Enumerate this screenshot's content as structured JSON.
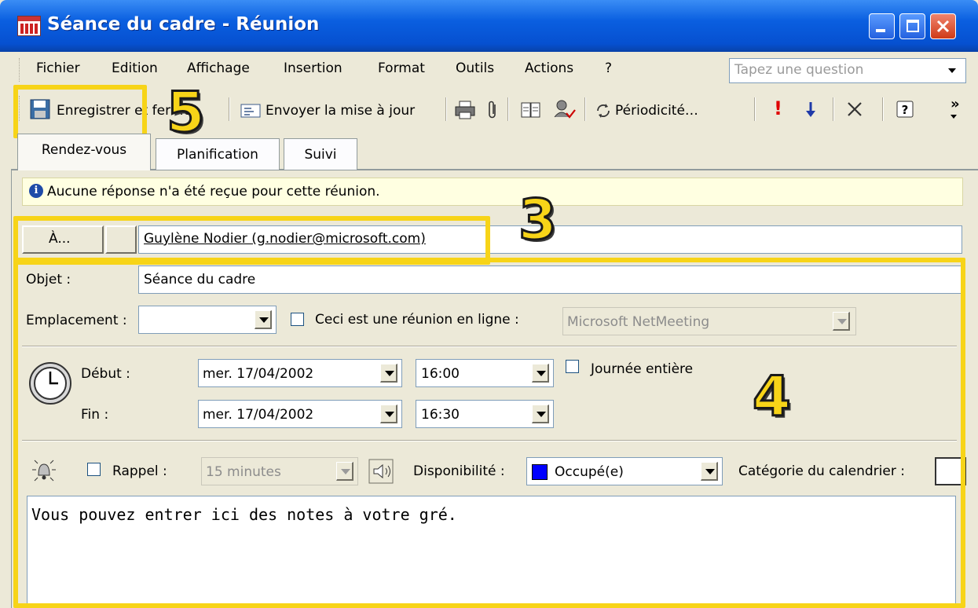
{
  "window": {
    "title": "Séance du cadre - Réunion"
  },
  "menu": {
    "items": [
      "Fichier",
      "Edition",
      "Affichage",
      "Insertion",
      "Format",
      "Outils",
      "Actions",
      "?"
    ],
    "ask_placeholder": "Tapez une question"
  },
  "toolbar": {
    "save_label": "Enregistrer et fermer",
    "send_update_label": "Envoyer la mise à jour",
    "recurrence_label": "Périodicité…",
    "overflow": "»"
  },
  "tabs": [
    "Rendez-vous",
    "Planification",
    "Suivi"
  ],
  "infobar": {
    "text": "Aucune réponse n'a été reçue pour cette réunion."
  },
  "to": {
    "button_label": "À...",
    "value": "Guylène Nodier (g.nodier@microsoft.com)"
  },
  "subject": {
    "label": "Objet :",
    "value": "Séance du cadre"
  },
  "location": {
    "label": "Emplacement :",
    "value": "",
    "online_label": "Ceci est une réunion en ligne :",
    "online_checked": false,
    "online_service": "Microsoft NetMeeting"
  },
  "start": {
    "label": "Début :",
    "date": "mer. 17/04/2002",
    "time": "16:00"
  },
  "end": {
    "label": "Fin :",
    "date": "mer. 17/04/2002",
    "time": "16:30"
  },
  "all_day": {
    "label": "Journée entière",
    "checked": false
  },
  "reminder": {
    "label": "Rappel :",
    "checked": false,
    "value": "15 minutes"
  },
  "availability": {
    "label": "Disponibilité :",
    "value": "Occupé(e)",
    "color": "#0000ff"
  },
  "calendar_category": {
    "label": "Catégorie du calendrier :"
  },
  "notes": {
    "text": "Vous pouvez entrer ici des notes à votre gré."
  },
  "annotations": {
    "n5": "5",
    "n3": "3",
    "n4": "4"
  },
  "colors": {
    "annotation": "#f7d418",
    "titlebar": "#0a5fe0",
    "infobar": "#ffffe1"
  }
}
